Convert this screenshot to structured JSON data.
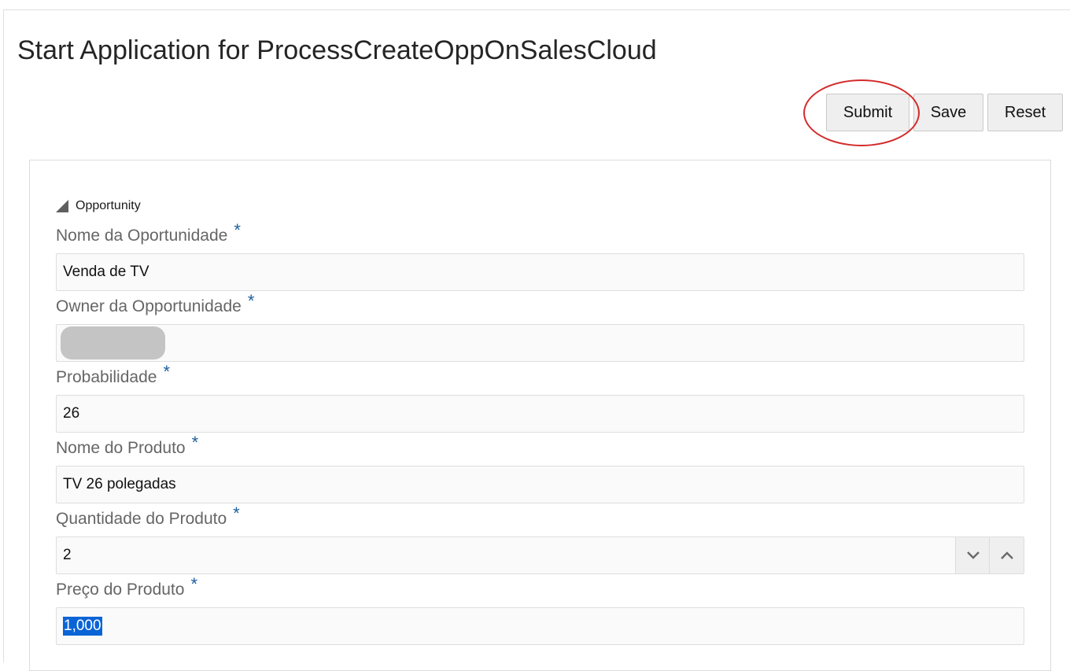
{
  "page": {
    "title": "Start Application for ProcessCreateOppOnSalesCloud"
  },
  "toolbar": {
    "submit_label": "Submit",
    "save_label": "Save",
    "reset_label": "Reset"
  },
  "section": {
    "label": "Opportunity",
    "toggle_icon": "collapse-triangle-icon"
  },
  "fields": {
    "opportunity_name": {
      "label": "Nome da Oportunidade",
      "required_marker": "*",
      "value": "Venda de TV"
    },
    "opportunity_owner": {
      "label": "Owner da Opportunidade",
      "required_marker": "*"
    },
    "probability": {
      "label": "Probabilidade",
      "required_marker": "*",
      "value": "26"
    },
    "product_name": {
      "label": "Nome do Produto",
      "required_marker": "*",
      "value": "TV 26 polegadas"
    },
    "product_quantity": {
      "label": "Quantidade do Produto",
      "required_marker": "*",
      "value": "2",
      "decrement_icon": "chevron-down-icon",
      "increment_icon": "chevron-up-icon"
    },
    "product_price": {
      "label": "Preço do Produto",
      "required_marker": "*",
      "value": "1,000"
    }
  },
  "colors": {
    "required_marker": "#1c5f9e",
    "annotation": "#d42a2a",
    "selection": "#0a64d6"
  }
}
